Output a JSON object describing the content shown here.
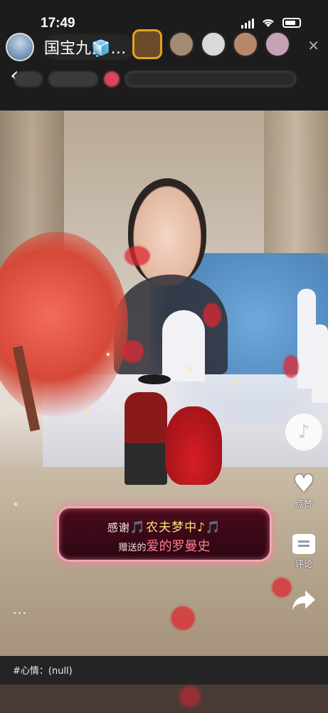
{
  "status_bar": {
    "time": "17:49"
  },
  "header": {
    "username": "国宝九🧊…",
    "back_icon": "chevron-left-icon",
    "close_icon": "close-icon"
  },
  "gift_banner": {
    "line1_prefix": "感谢",
    "line1_name": "🎵农夫梦中♪🎵",
    "line2_prefix": "赠送的",
    "line2_gift": "爱的罗曼史"
  },
  "right_rail": {
    "like_label": "点赞",
    "comment_label": "评论"
  },
  "more_dots": "...",
  "caption": {
    "text": "#心情：(null)"
  },
  "colors": {
    "header_bg": "#1c1c1c",
    "gift_border": "#f2a6b3",
    "gift_bg": "#3a0916"
  }
}
